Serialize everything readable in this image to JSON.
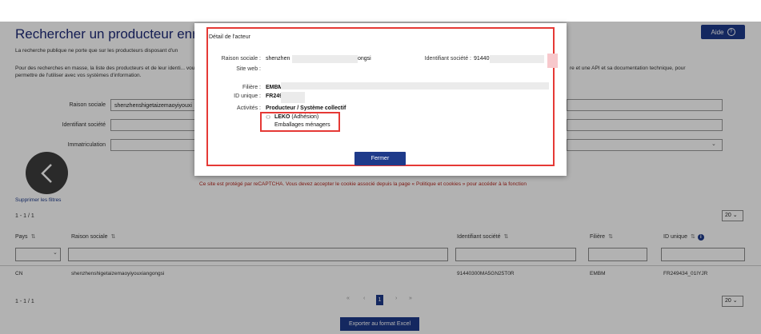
{
  "page": {
    "title": "Rechercher un producteur enregistré",
    "help_label": "Aide",
    "intro_line1": "La recherche publique ne porte que sur les producteurs disposant d'un",
    "intro_para": "Pour des recherches en masse, la liste des producteurs et de leur identi... vous permettre de l'utiliser avec vos systèmes d'information.",
    "intro_right": "re et une API et sa documentation technique, pour",
    "recaptcha_notice": "Ce site est protégé par reCAPTCHA. Vous devez accepter le cookie associé depuis la page « Politique et cookies » pour accéder à la fonction",
    "clear_filters": "Supprimer les filtres",
    "count_top": "1 - 1 / 1",
    "count_bottom": "1 - 1 / 1",
    "per_page": "20",
    "export_label": "Exporter au format Excel",
    "current_page": "1"
  },
  "search": {
    "raison_sociale_label": "Raison sociale",
    "raison_sociale_value": "shenzhenshigetaizemaoyiyouxi",
    "identifiant_label": "Identifiant société",
    "immatriculation_label": "Immatriculation"
  },
  "table": {
    "columns": [
      "Pays",
      "Raison sociale",
      "Identifiant société",
      "Filière",
      "ID unique"
    ],
    "row": {
      "pays": "CN",
      "raison_sociale": "shenzhenshigetaizemaoyiyouxiangongsi",
      "identifiant": "91440300MA5GN25T0R",
      "filiere": "EMBM",
      "id_unique": "FR249434_01IYJR"
    }
  },
  "modal": {
    "title": "Détail de l'acteur",
    "raison_sociale_label": "Raison sociale :",
    "raison_sociale_start": "shenzhen",
    "raison_sociale_end": "ongsi",
    "site_web_label": "Site web :",
    "identifiant_label": "Identifiant société :",
    "identifiant_value": "91440",
    "filiere_label": "Filière :",
    "filiere_value": "EMBM",
    "id_unique_label": "ID unique :",
    "id_unique_value": "FR249",
    "activites_label": "Activités :",
    "activites_value": "Producteur / Système collectif",
    "eco_name": "LEKO",
    "eco_status": "(Adhésion)",
    "eco_category": "Emballages ménagers",
    "close_label": "Fermer"
  },
  "colors": {
    "primary": "#1e3a8a",
    "highlight": "#e53935",
    "notice": "#b3261e"
  }
}
